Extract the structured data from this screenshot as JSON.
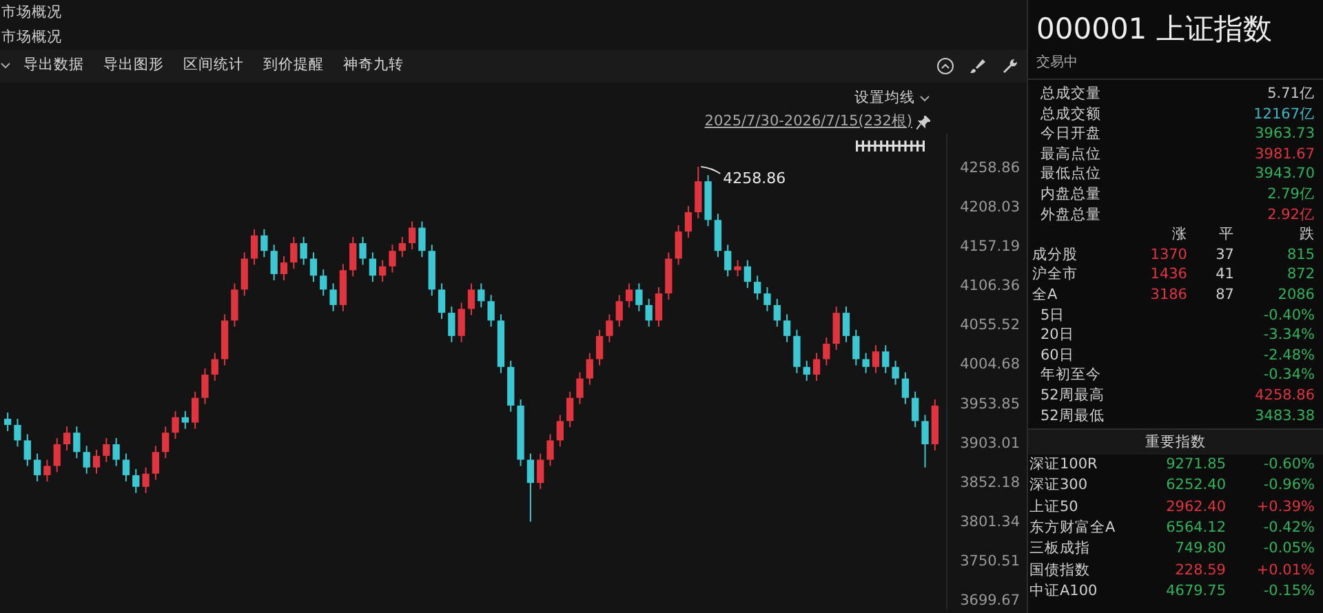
{
  "breadcrumbs": [
    "市场概况",
    "市场概况"
  ],
  "toolbar": {
    "items": [
      "导出数据",
      "导出图形",
      "区间统计",
      "到价提醒",
      "神奇九转"
    ]
  },
  "ma_setting": "设置均线",
  "date_range": "2025/7/30-2026/7/15(232根)",
  "peak_label": "4258.86",
  "chart_data": {
    "type": "candlestick",
    "ylim": [
      3687.2,
      4301.6
    ],
    "categories": [
      null,
      null,
      null,
      null,
      null,
      null,
      null,
      null,
      null,
      null,
      null,
      null,
      null,
      null,
      null,
      null,
      null,
      null,
      null,
      null,
      null,
      null,
      null,
      null,
      null,
      null,
      null,
      null,
      null,
      null,
      null,
      null,
      null,
      null,
      null,
      null,
      null,
      null,
      null,
      null,
      null,
      null,
      null,
      null,
      null,
      null,
      null,
      null,
      null,
      null,
      null,
      null,
      null,
      null,
      null,
      null,
      null,
      null,
      null,
      null,
      null,
      null,
      null,
      null,
      null,
      null,
      null,
      null,
      null,
      null,
      null,
      null,
      null,
      null,
      null,
      null,
      null,
      null,
      null,
      null,
      null,
      null,
      null,
      null,
      null,
      null,
      null,
      null,
      null,
      null,
      null,
      null,
      null,
      null,
      null
    ],
    "yticks": [
      {
        "value": 4258.86,
        "label": "4258.86"
      },
      {
        "value": 4208.03,
        "label": "4208.03"
      },
      {
        "value": 4157.19,
        "label": "4157.19"
      },
      {
        "value": 4106.36,
        "label": "4106.36"
      },
      {
        "value": 4055.52,
        "label": "4055.52"
      },
      {
        "value": 4004.68,
        "label": "4004.68"
      },
      {
        "value": 3953.85,
        "label": "3953.85"
      },
      {
        "value": 3903.01,
        "label": "3903.01"
      },
      {
        "value": 3852.18,
        "label": "3852.18"
      },
      {
        "value": 3801.34,
        "label": "3801.34"
      },
      {
        "value": 3750.51,
        "label": "3750.51"
      },
      {
        "value": 3699.67,
        "label": "3699.67"
      }
    ],
    "ohlc": [
      [
        3933,
        3941,
        3917,
        3925
      ],
      [
        3925,
        3933,
        3897,
        3905
      ],
      [
        3905,
        3913,
        3872,
        3880
      ],
      [
        3880,
        3888,
        3852,
        3860
      ],
      [
        3860,
        3880,
        3852,
        3872
      ],
      [
        3872,
        3908,
        3864,
        3900
      ],
      [
        3900,
        3923,
        3892,
        3915
      ],
      [
        3915,
        3923,
        3882,
        3890
      ],
      [
        3890,
        3898,
        3862,
        3870
      ],
      [
        3870,
        3893,
        3862,
        3885
      ],
      [
        3885,
        3908,
        3877,
        3900
      ],
      [
        3900,
        3908,
        3872,
        3880
      ],
      [
        3880,
        3888,
        3852,
        3860
      ],
      [
        3860,
        3868,
        3837,
        3845
      ],
      [
        3845,
        3870,
        3837,
        3862
      ],
      [
        3862,
        3898,
        3854,
        3890
      ],
      [
        3890,
        3923,
        3882,
        3915
      ],
      [
        3915,
        3943,
        3907,
        3935
      ],
      [
        3935,
        3943,
        3920,
        3928
      ],
      [
        3928,
        3968,
        3920,
        3960
      ],
      [
        3960,
        3998,
        3952,
        3990
      ],
      [
        3990,
        4018,
        3982,
        4010
      ],
      [
        4010,
        4068,
        4002,
        4060
      ],
      [
        4060,
        4108,
        4052,
        4100
      ],
      [
        4100,
        4148,
        4092,
        4140
      ],
      [
        4140,
        4178,
        4132,
        4170
      ],
      [
        4170,
        4178,
        4142,
        4150
      ],
      [
        4150,
        4158,
        4112,
        4120
      ],
      [
        4120,
        4143,
        4112,
        4135
      ],
      [
        4135,
        4168,
        4127,
        4160
      ],
      [
        4160,
        4168,
        4132,
        4140
      ],
      [
        4140,
        4148,
        4110,
        4118
      ],
      [
        4118,
        4126,
        4092,
        4100
      ],
      [
        4100,
        4108,
        4072,
        4080
      ],
      [
        4080,
        4133,
        4072,
        4125
      ],
      [
        4125,
        4168,
        4117,
        4160
      ],
      [
        4160,
        4168,
        4132,
        4140
      ],
      [
        4140,
        4148,
        4110,
        4118
      ],
      [
        4118,
        4138,
        4110,
        4130
      ],
      [
        4130,
        4158,
        4122,
        4150
      ],
      [
        4150,
        4168,
        4142,
        4160
      ],
      [
        4160,
        4188,
        4152,
        4180
      ],
      [
        4180,
        4188,
        4142,
        4150
      ],
      [
        4150,
        4158,
        4092,
        4100
      ],
      [
        4100,
        4108,
        4062,
        4070
      ],
      [
        4070,
        4078,
        4032,
        4040
      ],
      [
        4040,
        4083,
        4032,
        4075
      ],
      [
        4075,
        4108,
        4067,
        4100
      ],
      [
        4100,
        4108,
        4077,
        4085
      ],
      [
        4085,
        4093,
        4052,
        4060
      ],
      [
        4060,
        4068,
        3992,
        4000
      ],
      [
        4000,
        4008,
        3942,
        3950
      ],
      [
        3950,
        3958,
        3872,
        3880
      ],
      [
        3880,
        3888,
        3800,
        3850
      ],
      [
        3850,
        3888,
        3842,
        3880
      ],
      [
        3880,
        3913,
        3872,
        3905
      ],
      [
        3905,
        3938,
        3897,
        3930
      ],
      [
        3930,
        3968,
        3922,
        3960
      ],
      [
        3960,
        3993,
        3952,
        3985
      ],
      [
        3985,
        4018,
        3977,
        4010
      ],
      [
        4010,
        4048,
        4002,
        4040
      ],
      [
        4040,
        4068,
        4032,
        4060
      ],
      [
        4060,
        4093,
        4052,
        4085
      ],
      [
        4085,
        4108,
        4077,
        4100
      ],
      [
        4100,
        4108,
        4072,
        4080
      ],
      [
        4080,
        4088,
        4052,
        4060
      ],
      [
        4060,
        4103,
        4052,
        4095
      ],
      [
        4095,
        4148,
        4087,
        4140
      ],
      [
        4140,
        4183,
        4132,
        4175
      ],
      [
        4175,
        4208,
        4167,
        4200
      ],
      [
        4200,
        4258.86,
        4192,
        4240
      ],
      [
        4240,
        4248,
        4182,
        4190
      ],
      [
        4190,
        4198,
        4142,
        4150
      ],
      [
        4150,
        4158,
        4117,
        4125
      ],
      [
        4125,
        4138,
        4117,
        4130
      ],
      [
        4130,
        4138,
        4102,
        4110
      ],
      [
        4110,
        4118,
        4087,
        4095
      ],
      [
        4095,
        4103,
        4072,
        4080
      ],
      [
        4080,
        4088,
        4052,
        4060
      ],
      [
        4060,
        4068,
        4032,
        4040
      ],
      [
        4040,
        4048,
        3992,
        4000
      ],
      [
        4000,
        4008,
        3982,
        3990
      ],
      [
        3990,
        4018,
        3982,
        4010
      ],
      [
        4010,
        4038,
        4002,
        4030
      ],
      [
        4030,
        4078,
        4022,
        4070
      ],
      [
        4070,
        4078,
        4032,
        4040
      ],
      [
        4040,
        4048,
        4002,
        4010
      ],
      [
        4010,
        4018,
        3992,
        4000
      ],
      [
        4000,
        4028,
        3992,
        4020
      ],
      [
        4020,
        4028,
        3992,
        4000
      ],
      [
        4000,
        4008,
        3977,
        3985
      ],
      [
        3985,
        3993,
        3952,
        3960
      ],
      [
        3960,
        3968,
        3922,
        3930
      ],
      [
        3930,
        3938,
        3870,
        3900
      ],
      [
        3900,
        3958,
        3892,
        3950
      ]
    ]
  },
  "quote": {
    "code_name": "000001 上证指数",
    "status": "交易中",
    "stats": [
      {
        "label": "总成交量",
        "value": "5.71亿",
        "color": "#c8c8c8"
      },
      {
        "label": "总成交额",
        "value": "12167亿",
        "color": "#3ab8c4"
      },
      {
        "label": "今日开盘",
        "value": "3963.73",
        "color": "#2fb35a"
      },
      {
        "label": "最高点位",
        "value": "3981.67",
        "color": "#e0343f"
      },
      {
        "label": "最低点位",
        "value": "3943.70",
        "color": "#2fb35a"
      },
      {
        "label": "内盘总量",
        "value": "2.79亿",
        "color": "#2fb35a"
      },
      {
        "label": "外盘总量",
        "value": "2.92亿",
        "color": "#e0343f"
      }
    ],
    "breadth_columns": [
      "涨",
      "平",
      "跌"
    ],
    "breadth": [
      {
        "label": "成分股",
        "up": "1370",
        "flat": "37",
        "down": "815"
      },
      {
        "label": "沪全市",
        "up": "1436",
        "flat": "41",
        "down": "872"
      },
      {
        "label": "全A",
        "up": "3186",
        "flat": "87",
        "down": "2086"
      }
    ],
    "performance": [
      {
        "label": "5日",
        "value": "-0.40%",
        "color": "#2fb35a"
      },
      {
        "label": "20日",
        "value": "-3.34%",
        "color": "#2fb35a"
      },
      {
        "label": "60日",
        "value": "-2.48%",
        "color": "#2fb35a"
      },
      {
        "label": "年初至今",
        "value": "-0.34%",
        "color": "#2fb35a"
      },
      {
        "label": "52周最高",
        "value": "4258.86",
        "color": "#e0343f"
      },
      {
        "label": "52周最低",
        "value": "3483.38",
        "color": "#2fb35a"
      }
    ]
  },
  "key_indices": {
    "title": "重要指数",
    "rows": [
      {
        "name": "深证100R",
        "price": "9271.85",
        "change": "-0.60%",
        "color": "#2fb35a"
      },
      {
        "name": "深证300",
        "price": "6252.40",
        "change": "-0.96%",
        "color": "#2fb35a"
      },
      {
        "name": "上证50",
        "price": "2962.40",
        "change": "+0.39%",
        "color": "#e0343f"
      },
      {
        "name": "东方财富全A",
        "price": "6564.12",
        "change": "-0.42%",
        "color": "#2fb35a"
      },
      {
        "name": "三板成指",
        "price": "749.80",
        "change": "-0.05%",
        "color": "#2fb35a"
      },
      {
        "name": "国债指数",
        "price": "228.59",
        "change": "+0.01%",
        "color": "#e0343f"
      },
      {
        "name": "中证A100",
        "price": "4679.75",
        "change": "-0.15%",
        "color": "#2fb35a"
      }
    ]
  }
}
